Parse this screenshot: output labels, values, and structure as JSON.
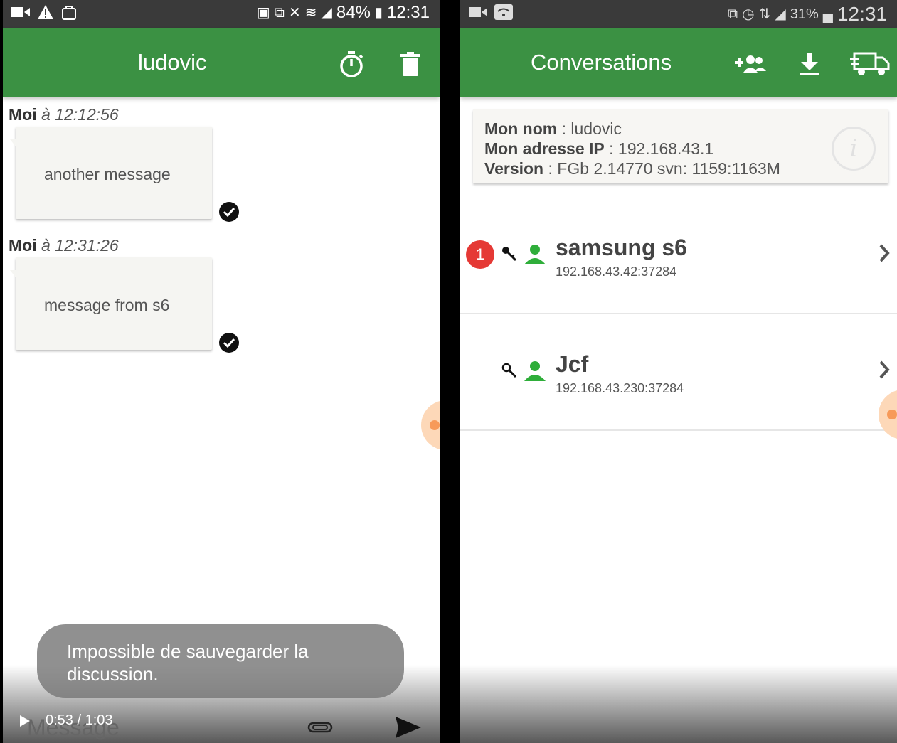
{
  "left": {
    "status": {
      "battery": "84%",
      "time": "12:31"
    },
    "appbar": {
      "title": "ludovic",
      "timer_icon": "stopwatch-icon",
      "delete_icon": "trash-icon"
    },
    "messages": [
      {
        "sender": "Moi",
        "prefix": "à",
        "time": "12:12:56",
        "text": "another message"
      },
      {
        "sender": "Moi",
        "prefix": "à",
        "time": "12:31:26",
        "text": "message from s6"
      }
    ],
    "toast": "Impossible de sauvegarder la discussion.",
    "input": {
      "placeholder": "Message"
    },
    "video": {
      "time": "0:53 / 1:03"
    }
  },
  "right": {
    "status": {
      "battery": "31%",
      "time": "12:31"
    },
    "appbar": {
      "title": "Conversations",
      "icons": [
        "add-group-icon",
        "download-icon",
        "delivery-truck-icon"
      ]
    },
    "info": {
      "name_label": "Mon nom",
      "name_value": ": ludovic",
      "ip_label": "Mon adresse IP",
      "ip_value": ": 192.168.43.1",
      "version_label": "Version",
      "version_value": ": FGb 2.14770 svn: 1159:1163M"
    },
    "contacts": [
      {
        "name": "samsung s6",
        "address": "192.168.43.42:37284",
        "unread": "1"
      },
      {
        "name": "Jcf",
        "address": "192.168.43.230:37284",
        "unread": ""
      }
    ]
  },
  "colors": {
    "appbar": "#3b9143",
    "badge": "#e53935",
    "person": "#2fae3a"
  }
}
